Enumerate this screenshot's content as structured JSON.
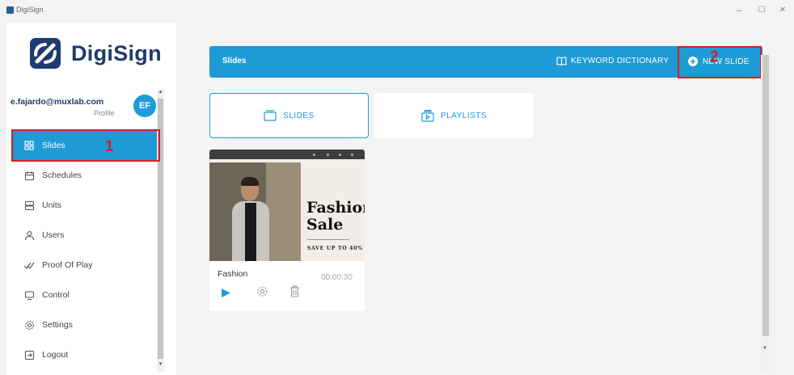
{
  "window": {
    "title": "DigiSign",
    "minimize": "–",
    "maximize": "☐",
    "close": "✕"
  },
  "sidebar": {
    "logo_text": "DigiSign",
    "user": {
      "email": "e.fajardo@muxlab.com",
      "profile_label": "Profile",
      "initials": "EF"
    },
    "items": [
      {
        "label": "Slides",
        "icon": "grid-icon",
        "active": true
      },
      {
        "label": "Schedules",
        "icon": "calendar-icon"
      },
      {
        "label": "Units",
        "icon": "server-icon"
      },
      {
        "label": "Users",
        "icon": "user-icon"
      },
      {
        "label": "Proof Of Play",
        "icon": "check-icon"
      },
      {
        "label": "Control",
        "icon": "monitor-icon"
      },
      {
        "label": "Settings",
        "icon": "gear-icon"
      },
      {
        "label": "Logout",
        "icon": "logout-icon"
      }
    ]
  },
  "header": {
    "title": "Slides",
    "keyword_dictionary": "KEYWORD DICTIONARY",
    "new_slide": "NEW SLIDE"
  },
  "tabs": [
    {
      "label": "SLIDES",
      "active": true
    },
    {
      "label": "PLAYLISTS"
    }
  ],
  "slides": [
    {
      "name": "Fashion",
      "duration": "00:00:30",
      "thumbnail": {
        "headline_1": "Fashion",
        "headline_2": "Sale",
        "subtext": "SAVE UP TO 40%"
      }
    }
  ],
  "annotations": {
    "marker_1": "1",
    "marker_2": "2",
    "color": "#d21f1f"
  },
  "colors": {
    "accent": "#1e9bd7",
    "brand_dark": "#1e3a6e"
  }
}
